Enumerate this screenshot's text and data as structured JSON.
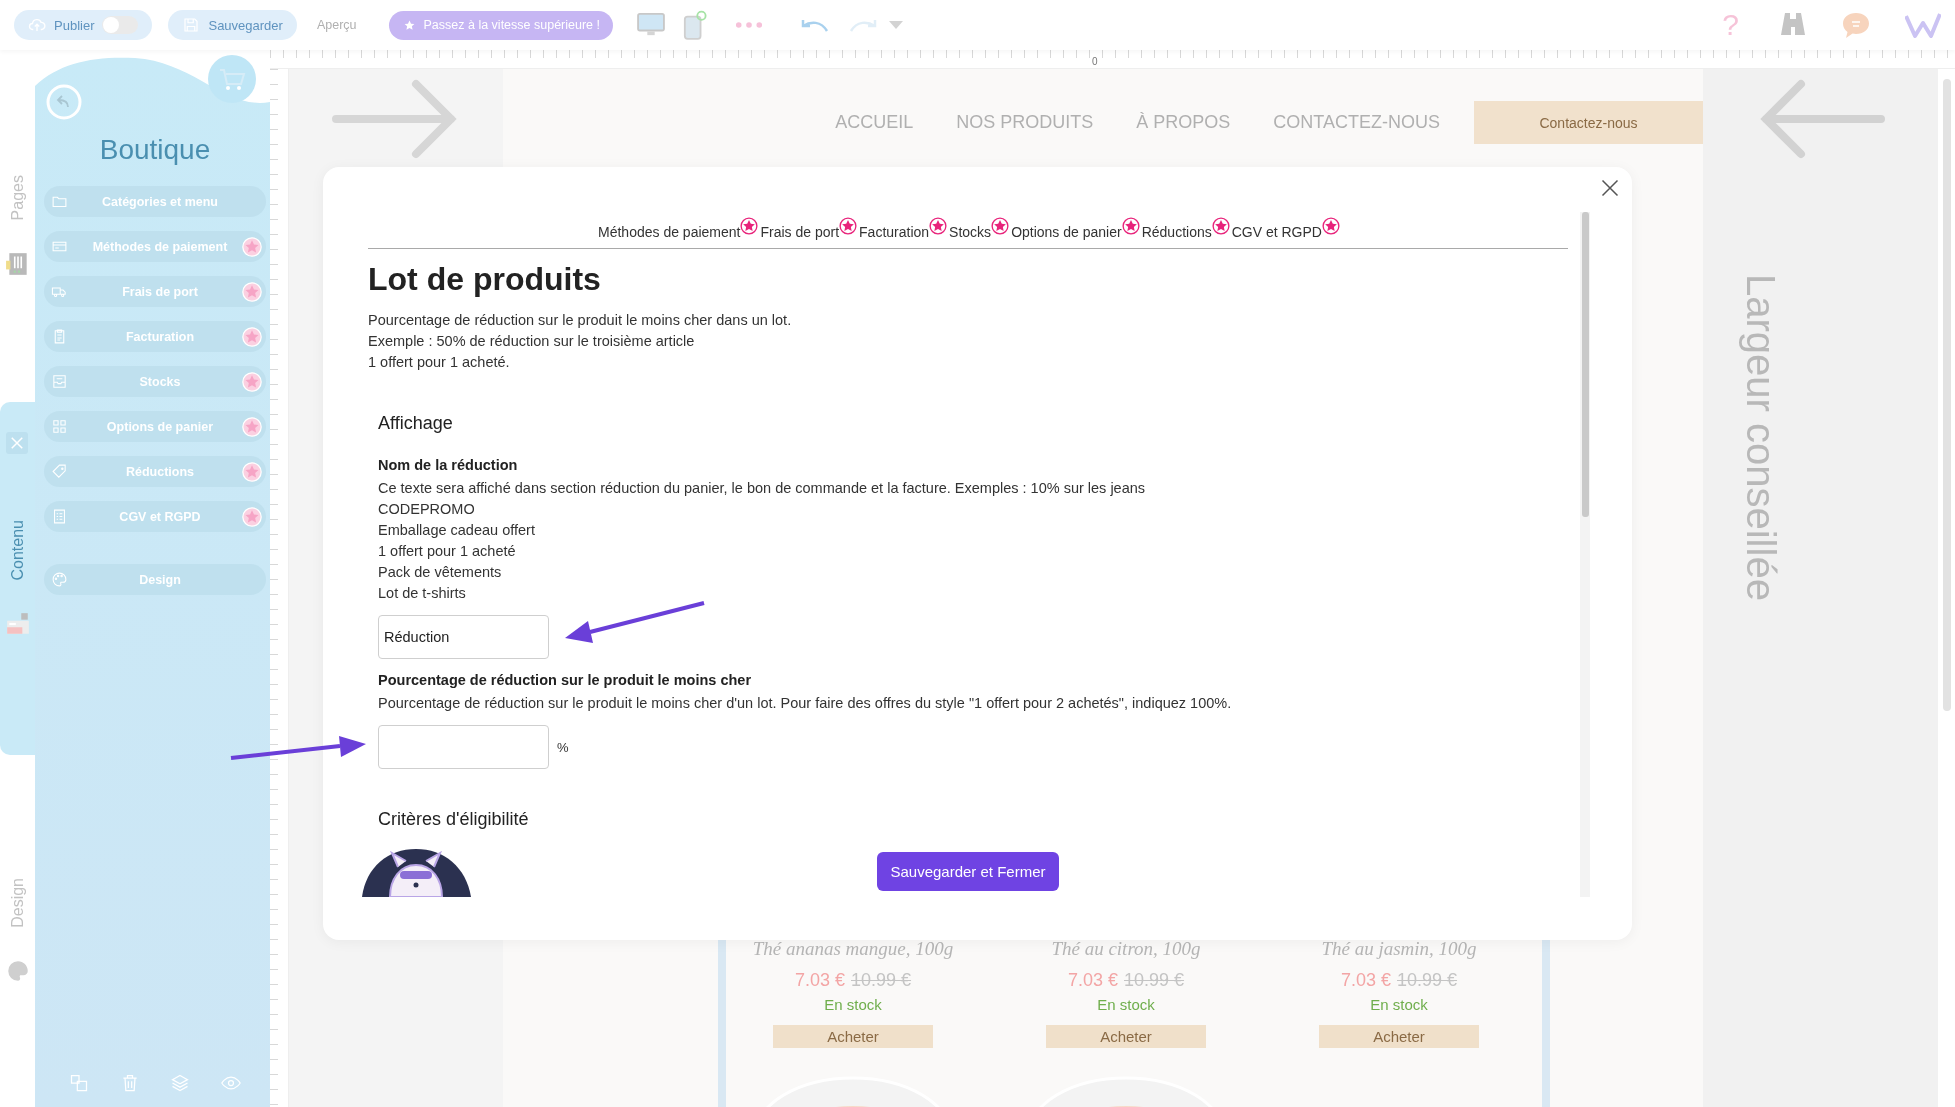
{
  "toolbar": {
    "publish": {
      "label": "Publier",
      "on": false
    },
    "save": "Sauvegarder",
    "preview": "Aperçu",
    "upgrade": "Passez à la vitesse supérieure !",
    "help": "?"
  },
  "rail": {
    "tabs": [
      {
        "label": "Pages",
        "selected": false
      },
      {
        "label": "Contenu",
        "selected": true
      },
      {
        "label": "Design",
        "selected": false
      }
    ]
  },
  "sidebar": {
    "title": "Boutique",
    "items": [
      {
        "label": "Catégories et menu",
        "premium": false
      },
      {
        "label": "Méthodes de paiement",
        "premium": true
      },
      {
        "label": "Frais de port",
        "premium": true
      },
      {
        "label": "Facturation",
        "premium": true
      },
      {
        "label": "Stocks",
        "premium": true
      },
      {
        "label": "Options de panier",
        "premium": true
      },
      {
        "label": "Réductions",
        "premium": true
      },
      {
        "label": "CGV et RGPD",
        "premium": true
      }
    ],
    "footer_item": {
      "label": "Design"
    }
  },
  "ruler": {
    "origin": "0"
  },
  "site": {
    "nav": [
      "ACCUEIL",
      "NOS PRODUITS",
      "À PROPOS",
      "CONTACTEZ-NOUS"
    ],
    "cta": "Contactez-nous",
    "width_hint": "Largeur conseillée",
    "products": [
      {
        "name": "Thé ananas mangue, 100g",
        "price": "7.03 €",
        "old_price": "10.99 €",
        "stock": "En stock",
        "button": "Acheter"
      },
      {
        "name": "Thé au citron, 100g",
        "price": "7.03 €",
        "old_price": "10.99 €",
        "stock": "En stock",
        "button": "Acheter"
      },
      {
        "name": "Thé au jasmin, 100g",
        "price": "7.03 €",
        "old_price": "10.99 €",
        "stock": "En stock",
        "button": "Acheter"
      }
    ]
  },
  "modal": {
    "tabs": [
      {
        "label": "Méthodes de paiement",
        "premium": true
      },
      {
        "label": "Frais de port",
        "premium": true
      },
      {
        "label": "Facturation",
        "premium": true
      },
      {
        "label": "Stocks",
        "premium": true
      },
      {
        "label": "Options de panier",
        "premium": true
      },
      {
        "label": "Réductions",
        "premium": true
      },
      {
        "label": "CGV et RGPD",
        "premium": true
      }
    ],
    "title": "Lot de produits",
    "intro": [
      "Pourcentage de réduction sur le produit le moins cher dans un lot.",
      "Exemple : 50% de réduction sur le troisième article",
      "1 offert pour 1 acheté."
    ],
    "sections": [
      {
        "kind": "heading",
        "text": "Affichage"
      },
      {
        "kind": "field",
        "label": "Nom de la réduction",
        "help": [
          "Ce texte sera affiché dans section réduction du panier, le bon de commande et la facture. Exemples : 10% sur les jeans",
          "CODEPROMO",
          "Emballage cadeau offert",
          "1 offert pour 1 acheté",
          "Pack de vêtements",
          "Lot de t-shirts"
        ],
        "value": "Réduction"
      },
      {
        "kind": "field",
        "label": "Pourcentage de réduction sur le produit le moins cher",
        "help": [
          "Pourcentage de réduction sur le produit le moins cher d'un lot. Pour faire des offres du style \"1 offert pour 2 achetés\", indiquez 100%."
        ],
        "unit": "%"
      },
      {
        "kind": "heading",
        "text": "Critères d'éligibilité"
      }
    ],
    "save_button": "Sauvegarder et Fermer"
  }
}
